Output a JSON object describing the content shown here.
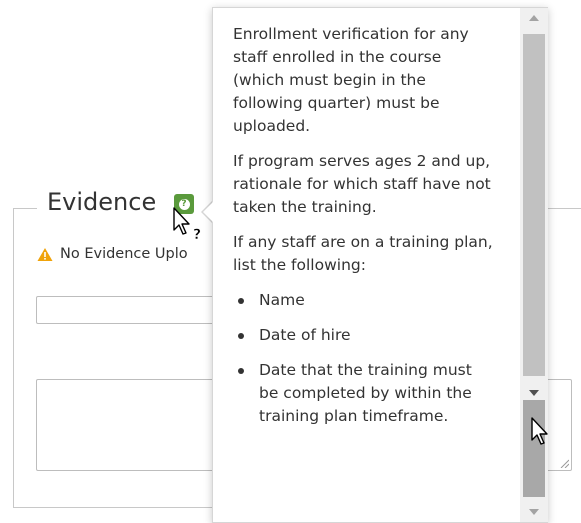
{
  "section": {
    "legend": "Evidence",
    "warning_text": "No Evidence Uplo"
  },
  "popover": {
    "paragraph_1": "Enrollment verification for any staff enrolled in the course (which must begin in the following quarter) must be uploaded.",
    "paragraph_2": "If program serves ages 2 and up, rationale for which staff have not taken the training.",
    "paragraph_3": "If any staff are on a training plan, list the following:",
    "list_items": [
      "Name",
      "Date of hire",
      "Date that the training must be completed by within the training plan timeframe."
    ]
  },
  "icons": {
    "help": "question-icon",
    "warning": "warning-icon",
    "cursor_help": "help-cursor-icon",
    "cursor_arrow": "arrow-cursor-icon"
  },
  "colors": {
    "help_icon": "#5a9a3c",
    "warning": "#f0a30a",
    "text": "#333333"
  }
}
